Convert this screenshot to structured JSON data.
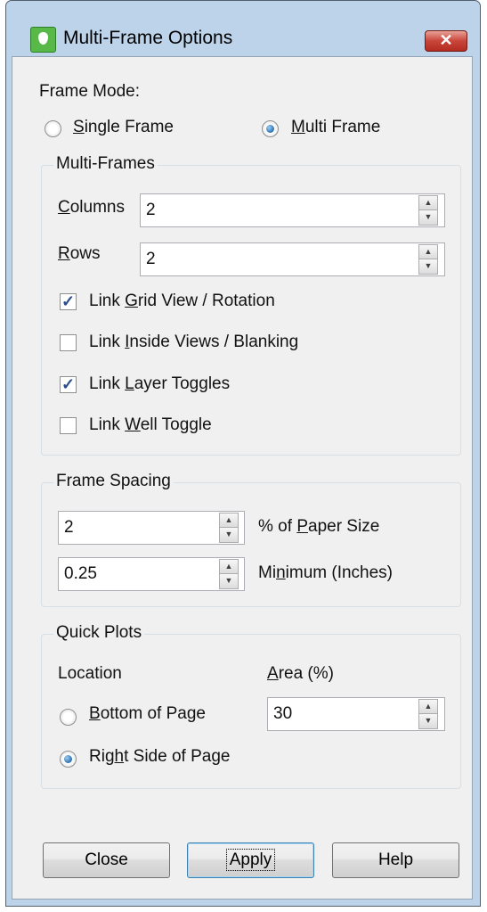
{
  "window": {
    "title": "Multi-Frame Options",
    "close_glyph": "✕"
  },
  "frame_mode": {
    "label": "Frame Mode:",
    "options": [
      {
        "label": "Single Frame",
        "selected": false
      },
      {
        "label": "Multi Frame",
        "selected": true
      }
    ]
  },
  "multi_frames": {
    "title": "Multi-Frames",
    "columns": {
      "label": "Columns",
      "value": "2"
    },
    "rows": {
      "label": "Rows",
      "value": "2"
    },
    "checks": [
      {
        "label": "Link Grid View / Rotation",
        "checked": true
      },
      {
        "label": "Link Inside Views / Blanking",
        "checked": false
      },
      {
        "label": "Link Layer Toggles",
        "checked": true
      },
      {
        "label": "Link Well Toggle",
        "checked": false
      }
    ]
  },
  "frame_spacing": {
    "title": "Frame Spacing",
    "percent": {
      "value": "2",
      "label": "% of Paper Size"
    },
    "minimum": {
      "value": "0.25",
      "label": "Minimum (Inches)"
    }
  },
  "quick_plots": {
    "title": "Quick Plots",
    "location_label": "Location",
    "area_label": "Area (%)",
    "area_value": "30",
    "options": [
      {
        "label": "Bottom of Page",
        "selected": false
      },
      {
        "label": "Right Side of Page",
        "selected": true
      }
    ]
  },
  "buttons": {
    "close": "Close",
    "apply": "Apply",
    "help": "Help"
  },
  "icons": {
    "spin_up": "▲",
    "spin_down": "▼",
    "check_mark": "✓"
  }
}
